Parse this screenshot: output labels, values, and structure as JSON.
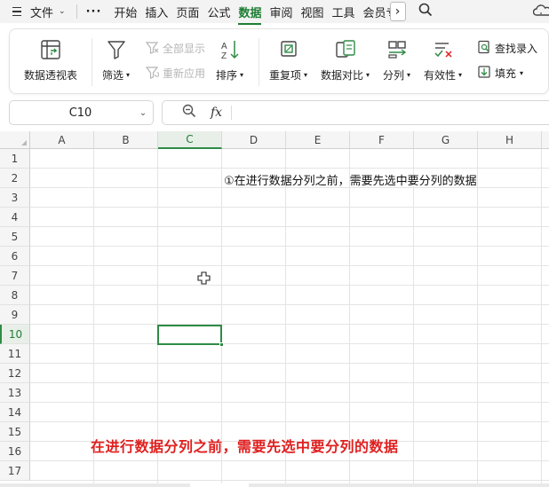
{
  "menubar": {
    "file_label": "文件",
    "more_label": "···",
    "tabs": [
      {
        "label": "开始",
        "active": false
      },
      {
        "label": "插入",
        "active": false
      },
      {
        "label": "页面",
        "active": false
      },
      {
        "label": "公式",
        "active": false
      },
      {
        "label": "数据",
        "active": true
      },
      {
        "label": "审阅",
        "active": false
      },
      {
        "label": "视图",
        "active": false
      },
      {
        "label": "工具",
        "active": false
      },
      {
        "label": "会员专享",
        "active": false
      }
    ]
  },
  "ribbon": {
    "pivot": "数据透视表",
    "filter": "筛选",
    "show_all": "全部显示",
    "reapply": "重新应用",
    "sort": "排序",
    "duplicates": "重复项",
    "compare": "数据对比",
    "split": "分列",
    "validity": "有效性",
    "find_entry": "查找录入",
    "fill": "填充"
  },
  "formula_bar": {
    "cell_ref": "C10",
    "fx_label": "fx",
    "formula": ""
  },
  "sheet": {
    "columns": [
      "A",
      "B",
      "C",
      "D",
      "E",
      "F",
      "G",
      "H"
    ],
    "rows": [
      "1",
      "2",
      "3",
      "4",
      "5",
      "6",
      "7",
      "8",
      "9",
      "10",
      "11",
      "12",
      "13",
      "14",
      "15",
      "16",
      "17"
    ],
    "selected_column": "C",
    "selected_row": "10",
    "d2_text": "①在进行数据分列之前，需要先选中要分列的数据"
  },
  "caption": "在进行数据分列之前，需要先选中要分列的数据",
  "colors": {
    "accent": "#1e7e34",
    "selection": "#2e8b46",
    "caption": "#e02020"
  }
}
